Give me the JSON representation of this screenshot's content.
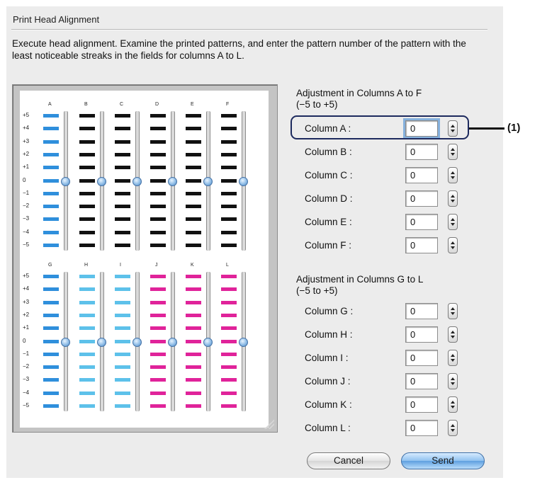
{
  "dialog": {
    "title": "Print Head Alignment",
    "instructions": "Execute head alignment. Examine the printed patterns, and enter the pattern number of the pattern with the least noticeable streaks in the fields for columns A to L."
  },
  "patterns": {
    "row_labels": [
      "+5",
      "+4",
      "+3",
      "+2",
      "+1",
      "0",
      "−1",
      "−2",
      "−3",
      "−4",
      "−5"
    ],
    "top_columns": [
      "A",
      "B",
      "C",
      "D",
      "E",
      "F"
    ],
    "bottom_columns": [
      "G",
      "H",
      "I",
      "J",
      "K",
      "L"
    ],
    "colors": {
      "blue": "#2f8fdc",
      "black": "#111111",
      "cyan": "#5dc1ea",
      "magenta": "#e0239a"
    },
    "top_colors": [
      "blue",
      "black",
      "black",
      "black",
      "black",
      "black"
    ],
    "bottom_colors": [
      "blue",
      "cyan",
      "cyan",
      "magenta",
      "magenta",
      "magenta"
    ]
  },
  "group1": {
    "heading_line1": "Adjustment in Columns A to F",
    "heading_line2": "(−5 to +5)",
    "rows": [
      {
        "label": "Column A :",
        "value": "0"
      },
      {
        "label": "Column B :",
        "value": "0"
      },
      {
        "label": "Column C :",
        "value": "0"
      },
      {
        "label": "Column D :",
        "value": "0"
      },
      {
        "label": "Column E :",
        "value": "0"
      },
      {
        "label": "Column F :",
        "value": "0"
      }
    ]
  },
  "group2": {
    "heading_line1": "Adjustment in Columns G to L",
    "heading_line2": "(−5 to +5)",
    "rows": [
      {
        "label": "Column G :",
        "value": "0"
      },
      {
        "label": "Column H :",
        "value": "0"
      },
      {
        "label": "Column I :",
        "value": "0"
      },
      {
        "label": "Column J :",
        "value": "0"
      },
      {
        "label": "Column K :",
        "value": "0"
      },
      {
        "label": "Column L :",
        "value": "0"
      }
    ]
  },
  "callout": {
    "label": "(1)"
  },
  "buttons": {
    "cancel": "Cancel",
    "send": "Send"
  }
}
